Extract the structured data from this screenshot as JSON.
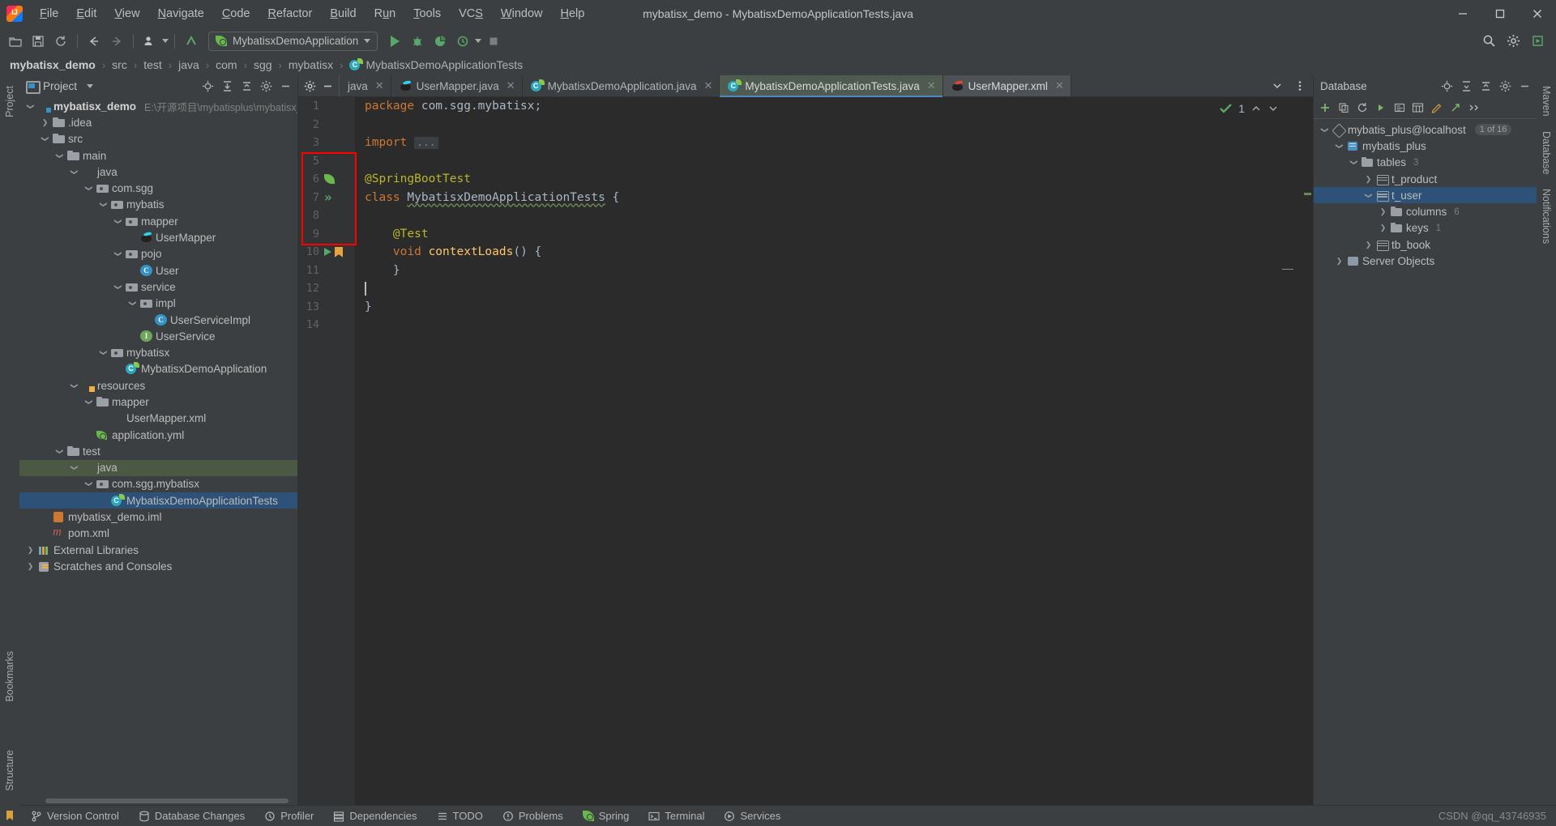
{
  "window": {
    "title": "mybatisx_demo - MybatisxDemoApplicationTests.java",
    "minimize_label": "—",
    "maximize_label": "❐",
    "close_label": "✕"
  },
  "menubar": {
    "items": [
      {
        "label": "File",
        "mnemonic": "F"
      },
      {
        "label": "Edit",
        "mnemonic": "E"
      },
      {
        "label": "View",
        "mnemonic": "V"
      },
      {
        "label": "Navigate",
        "mnemonic": "N"
      },
      {
        "label": "Code",
        "mnemonic": "C"
      },
      {
        "label": "Refactor",
        "mnemonic": "R"
      },
      {
        "label": "Build",
        "mnemonic": "B"
      },
      {
        "label": "Run",
        "mnemonic": "u"
      },
      {
        "label": "Tools",
        "mnemonic": "T"
      },
      {
        "label": "VCS",
        "mnemonic": "S"
      },
      {
        "label": "Window",
        "mnemonic": "W"
      },
      {
        "label": "Help",
        "mnemonic": "H"
      }
    ]
  },
  "toolbar": {
    "open_label": "Open",
    "save_label": "Save All",
    "sync_label": "Sync",
    "back_label": "Back",
    "forward_label": "Forward",
    "profile_label": "Profile",
    "update_label": "Update Project",
    "run_config_name": "MybatisxDemoApplication",
    "run_label": "Run",
    "debug_label": "Debug",
    "coverage_label": "Run with Coverage",
    "profiler_label": "Profiler",
    "stop_label": "Stop",
    "search_label": "Search Everywhere",
    "settings_label": "Settings",
    "ide_label": "IDE and Plugin Updates"
  },
  "breadcrumb": {
    "items": [
      {
        "label": "mybatisx_demo",
        "icon": "module-icon"
      },
      {
        "label": "src",
        "icon": "folder-icon"
      },
      {
        "label": "test",
        "icon": "folder-icon"
      },
      {
        "label": "java",
        "icon": "folder-icon"
      },
      {
        "label": "com",
        "icon": "package-icon"
      },
      {
        "label": "sgg",
        "icon": "package-icon"
      },
      {
        "label": "mybatisx",
        "icon": "package-icon"
      },
      {
        "label": "MybatisxDemoApplicationTests",
        "icon": "class-icon"
      }
    ],
    "separator": "›"
  },
  "left_strip": {
    "tabs": [
      {
        "label": "Project",
        "name": "tool-window-project"
      },
      {
        "label": "Bookmarks",
        "name": "tool-window-bookmarks"
      },
      {
        "label": "Structure",
        "name": "tool-window-structure"
      }
    ]
  },
  "right_strip": {
    "tabs": [
      {
        "label": "Maven",
        "name": "tool-window-maven"
      },
      {
        "label": "Database",
        "name": "tool-window-database"
      },
      {
        "label": "Notifications",
        "name": "tool-window-notifications"
      }
    ]
  },
  "project_panel": {
    "title": "Project",
    "actions": [
      "locate-icon",
      "expand-all-icon",
      "collapse-all-icon",
      "gear-icon",
      "hide-icon"
    ],
    "tree": [
      {
        "indent": 0,
        "arrow": "v",
        "icon": "folder-mod",
        "label": "mybatisx_demo",
        "bold": true,
        "path": "E:\\开源项目\\mybatisplus\\mybatisx_"
      },
      {
        "indent": 1,
        "arrow": ">",
        "icon": "folder",
        "label": ".idea"
      },
      {
        "indent": 1,
        "arrow": "v",
        "icon": "folder",
        "label": "src"
      },
      {
        "indent": 2,
        "arrow": "v",
        "icon": "folder",
        "label": "main"
      },
      {
        "indent": 3,
        "arrow": "v",
        "icon": "folder-src",
        "label": "java"
      },
      {
        "indent": 4,
        "arrow": "v",
        "icon": "pkg",
        "label": "com.sgg"
      },
      {
        "indent": 5,
        "arrow": "v",
        "icon": "pkg",
        "label": "mybatis"
      },
      {
        "indent": 6,
        "arrow": "v",
        "icon": "pkg",
        "label": "mapper"
      },
      {
        "indent": 7,
        "arrow": "none",
        "icon": "mybatis",
        "label": "UserMapper"
      },
      {
        "indent": 6,
        "arrow": "v",
        "icon": "pkg",
        "label": "pojo"
      },
      {
        "indent": 7,
        "arrow": "none",
        "icon": "cls",
        "label": "User"
      },
      {
        "indent": 6,
        "arrow": "v",
        "icon": "pkg",
        "label": "service"
      },
      {
        "indent": 7,
        "arrow": "v",
        "icon": "pkg",
        "label": "impl"
      },
      {
        "indent": 8,
        "arrow": "none",
        "icon": "cls",
        "label": "UserServiceImpl"
      },
      {
        "indent": 7,
        "arrow": "none",
        "icon": "iface",
        "label": "UserService"
      },
      {
        "indent": 5,
        "arrow": "v",
        "icon": "pkg",
        "label": "mybatisx"
      },
      {
        "indent": 6,
        "arrow": "none",
        "icon": "spring",
        "label": "MybatisxDemoApplication"
      },
      {
        "indent": 3,
        "arrow": "v",
        "icon": "folder-res",
        "label": "resources"
      },
      {
        "indent": 4,
        "arrow": "v",
        "icon": "folder",
        "label": "mapper"
      },
      {
        "indent": 5,
        "arrow": "none",
        "icon": "mybatis-xml",
        "label": "UserMapper.xml"
      },
      {
        "indent": 4,
        "arrow": "none",
        "icon": "yml",
        "label": "application.yml"
      },
      {
        "indent": 2,
        "arrow": "v",
        "icon": "folder",
        "label": "test"
      },
      {
        "indent": 3,
        "arrow": "v",
        "icon": "folder-test",
        "label": "java",
        "state": "hl"
      },
      {
        "indent": 4,
        "arrow": "v",
        "icon": "pkg",
        "label": "com.sgg.mybatisx"
      },
      {
        "indent": 5,
        "arrow": "none",
        "icon": "spring",
        "label": "MybatisxDemoApplicationTests",
        "state": "sel"
      },
      {
        "indent": 1,
        "arrow": "none",
        "icon": "iml",
        "label": "mybatisx_demo.iml"
      },
      {
        "indent": 1,
        "arrow": "none",
        "icon": "maven",
        "label": "pom.xml"
      },
      {
        "indent": 0,
        "arrow": ">",
        "icon": "libs",
        "label": "External Libraries"
      },
      {
        "indent": 0,
        "arrow": ">",
        "icon": "scratch",
        "label": "Scratches and Consoles"
      }
    ]
  },
  "editor": {
    "tabs": [
      {
        "label": "java",
        "icon": "folder-icon",
        "state": "normal",
        "closable": true
      },
      {
        "label": "UserMapper.java",
        "icon": "mybatis-icon",
        "state": "normal",
        "closable": true
      },
      {
        "label": "MybatisxDemoApplication.java",
        "icon": "spring-icon",
        "state": "normal",
        "closable": true
      },
      {
        "label": "MybatisxDemoApplicationTests.java",
        "icon": "spring-icon",
        "state": "selected",
        "closable": true
      },
      {
        "label": "UserMapper.xml",
        "icon": "mybatis-xml-icon",
        "state": "active",
        "closable": true
      }
    ],
    "tab_actions": [
      "gear-icon",
      "hide-icon"
    ],
    "tabs_right_actions": [
      "chevron-down-icon",
      "more-options-icon"
    ],
    "inspection_status": {
      "icon": "checkmark-icon",
      "count": "1",
      "up": "⌃",
      "down": "⌄"
    },
    "lines": [
      {
        "num": "1",
        "gutter": [],
        "tokens": [
          {
            "t": "package",
            "c": "k"
          },
          {
            "t": " com.sgg.mybatisx;",
            "c": "pl"
          }
        ]
      },
      {
        "num": "2",
        "gutter": [],
        "tokens": []
      },
      {
        "num": "3",
        "gutter": [],
        "tokens": [
          {
            "t": "import",
            "c": "k"
          },
          {
            "t": " ",
            "c": "pl"
          },
          {
            "t": "...",
            "c": "fold"
          }
        ]
      },
      {
        "num": "5",
        "gutter": [],
        "tokens": []
      },
      {
        "num": "6",
        "gutter": [
          "spring-leaf-icon"
        ],
        "tokens": [
          {
            "t": "@SpringBootTest",
            "c": "ann"
          }
        ]
      },
      {
        "num": "7",
        "gutter": [
          "run-all-tests-icon"
        ],
        "tokens": [
          {
            "t": "class",
            "c": "k"
          },
          {
            "t": " ",
            "c": "pl"
          },
          {
            "t": "MybatisxDemoApplicationTests",
            "c": "cls-nm"
          },
          {
            "t": " {",
            "c": "pl"
          }
        ]
      },
      {
        "num": "8",
        "gutter": [],
        "tokens": []
      },
      {
        "num": "9",
        "gutter": [],
        "tokens": [
          {
            "t": "    @Test",
            "c": "ann"
          }
        ]
      },
      {
        "num": "10",
        "gutter": [
          "run-test-icon",
          "bookmark-icon"
        ],
        "tokens": [
          {
            "t": "    ",
            "c": "pl"
          },
          {
            "t": "void",
            "c": "k"
          },
          {
            "t": " ",
            "c": "pl"
          },
          {
            "t": "contextLoads",
            "c": "mtd"
          },
          {
            "t": "() {",
            "c": "pl"
          }
        ]
      },
      {
        "num": "11",
        "gutter": [],
        "tokens": [
          {
            "t": "    }",
            "c": "pl"
          }
        ]
      },
      {
        "num": "12",
        "gutter": [],
        "tokens": [
          {
            "t": "",
            "c": "pl",
            "caret": true
          }
        ]
      },
      {
        "num": "13",
        "gutter": [],
        "tokens": [
          {
            "t": "}",
            "c": "pl"
          }
        ]
      },
      {
        "num": "14",
        "gutter": [],
        "tokens": []
      }
    ],
    "highlight_box": {
      "label": "gutter-highlight-box",
      "color": "#ff0000"
    }
  },
  "database_panel": {
    "title": "Database",
    "toolbar_actions": [
      "sync-icon",
      "filter-icon",
      "collapse-icon",
      "gear-icon",
      "hide-icon",
      "expand-icon"
    ],
    "actions_row": [
      "add-icon",
      "copy-icon",
      "refresh-icon",
      "run-query-icon",
      "properties-icon",
      "table-icon",
      "edit-icon",
      "jump-icon",
      "more-icon"
    ],
    "tree": [
      {
        "indent": 0,
        "arrow": "v",
        "icon": "dbconn",
        "label": "mybatis_plus@localhost",
        "pill": "1 of 16"
      },
      {
        "indent": 1,
        "arrow": "v",
        "icon": "dbsch",
        "label": "mybatis_plus"
      },
      {
        "indent": 2,
        "arrow": "v",
        "icon": "dbfolder",
        "label": "tables",
        "count": "3"
      },
      {
        "indent": 3,
        "arrow": ">",
        "icon": "dbtable",
        "label": "t_product"
      },
      {
        "indent": 3,
        "arrow": "v",
        "icon": "dbtable",
        "label": "t_user",
        "state": "sel"
      },
      {
        "indent": 4,
        "arrow": ">",
        "icon": "dbfolder",
        "label": "columns",
        "count": "6"
      },
      {
        "indent": 4,
        "arrow": ">",
        "icon": "dbfolder",
        "label": "keys",
        "count": "1"
      },
      {
        "indent": 3,
        "arrow": ">",
        "icon": "dbtable",
        "label": "tb_book"
      },
      {
        "indent": 1,
        "arrow": ">",
        "icon": "dbserver",
        "label": "Server Objects"
      }
    ]
  },
  "statusbar": {
    "items": [
      {
        "label": "Version Control",
        "icon": "branch-icon"
      },
      {
        "label": "Database Changes",
        "icon": "db-changes-icon"
      },
      {
        "label": "Profiler",
        "icon": "profiler-icon"
      },
      {
        "label": "Dependencies",
        "icon": "dependencies-icon"
      },
      {
        "label": "TODO",
        "icon": "todo-icon"
      },
      {
        "label": "Problems",
        "icon": "problems-icon"
      },
      {
        "label": "Spring",
        "icon": "spring-icon"
      },
      {
        "label": "Terminal",
        "icon": "terminal-icon"
      },
      {
        "label": "Services",
        "icon": "services-icon"
      }
    ],
    "watermark": "CSDN @qq_43746935"
  },
  "colors": {
    "accent_blue": "#4a88c7",
    "selection_blue": "#2d5177",
    "green": "#59a869",
    "orange": "#cc7832",
    "yellow": "#bbb529",
    "panel_bg": "#3c3f41",
    "editor_bg": "#2b2b2b",
    "highlight_red": "#ff0000"
  }
}
